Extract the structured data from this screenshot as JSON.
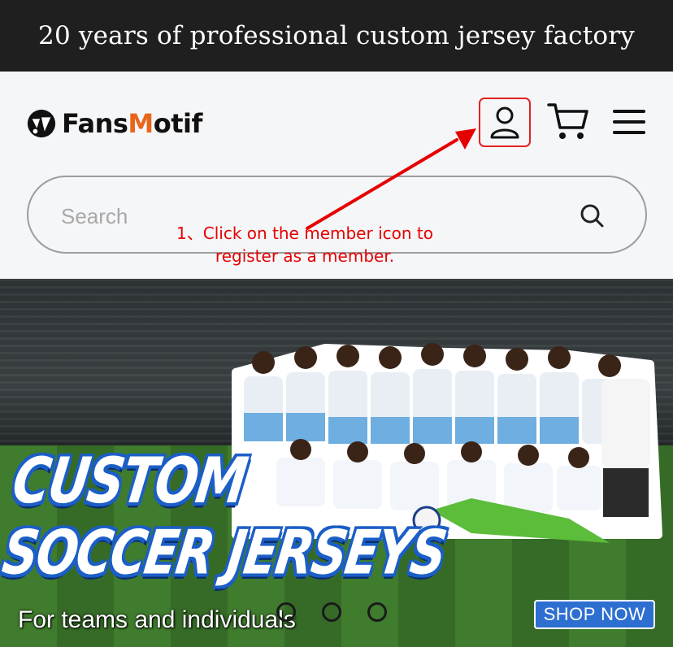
{
  "top_bar": {
    "text": "20 years of professional custom jersey factory"
  },
  "header": {
    "logo": {
      "prefix": "Fans",
      "highlight": "M",
      "suffix": "otif"
    },
    "icons": [
      "member-icon",
      "cart-icon",
      "menu-icon"
    ],
    "accent_color": "#e8651a",
    "highlight_border_color": "#e32222"
  },
  "search": {
    "placeholder": "Search",
    "value": ""
  },
  "annotation": {
    "line1": "1、Click on the member icon to",
    "line2": "register as a member.",
    "color": "#e60000"
  },
  "banner": {
    "title_line1": "CUSTOM",
    "title_line2": "SOCCER JERSEYS",
    "subtitle": "For teams and individuals",
    "cta_label": "SHOP NOW",
    "carousel_slide_count": 3
  }
}
